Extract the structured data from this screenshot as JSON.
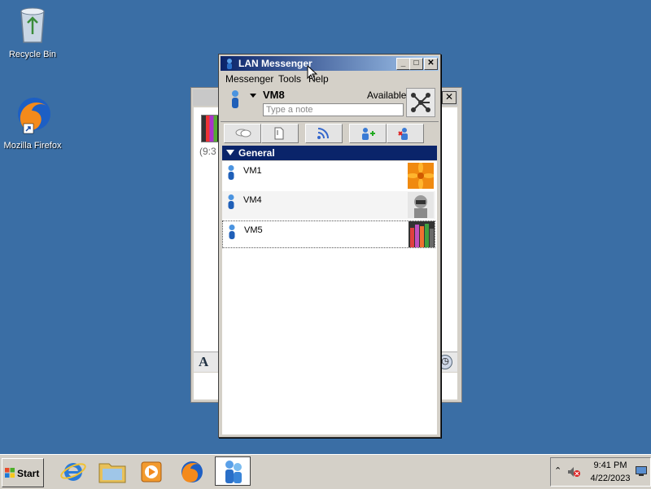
{
  "desktop": {
    "icons": [
      {
        "label": "Recycle Bin"
      },
      {
        "label": "Mozilla Firefox"
      }
    ]
  },
  "chat_window": {
    "timestamp": "(9:3"
  },
  "messenger": {
    "title": "LAN Messenger",
    "menu": [
      "Messenger",
      "Tools",
      "Help"
    ],
    "user": {
      "name": "VM8",
      "status": "Available",
      "note_placeholder": "Type a note"
    },
    "group": "General",
    "contacts": [
      {
        "name": "VM1"
      },
      {
        "name": "VM4"
      },
      {
        "name": "VM5"
      }
    ]
  },
  "taskbar": {
    "start_label": "Start",
    "time": "9:41 PM",
    "date": "4/22/2023"
  },
  "colors": {
    "desktop": "#3a6ea5",
    "titlebar": "#0a246a",
    "group_header": "#0a246a"
  }
}
